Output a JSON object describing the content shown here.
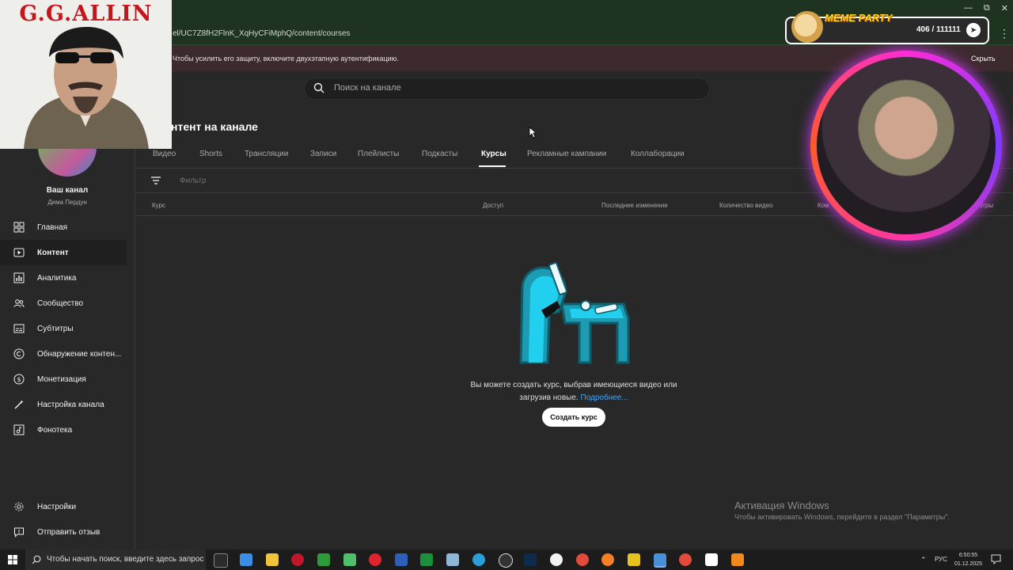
{
  "browser": {
    "url": "el/UC7Z8fH2FlnK_XqHyCFiMphQ/content/courses"
  },
  "alert": {
    "text": "Чтобы усилить его защиту, включите двухэтапную аутентификацию.",
    "hide_label": "Скрыть"
  },
  "search": {
    "placeholder": "Поиск на канале"
  },
  "sidebar": {
    "channel_name": "Ваш канал",
    "channel_handle": "Дима Пердун",
    "items": [
      {
        "label": "Главная"
      },
      {
        "label": "Контент"
      },
      {
        "label": "Аналитика"
      },
      {
        "label": "Сообщество"
      },
      {
        "label": "Субтитры"
      },
      {
        "label": "Обнаружение контен..."
      },
      {
        "label": "Монетизация"
      },
      {
        "label": "Настройка канала"
      },
      {
        "label": "Фонотека"
      }
    ],
    "bottom_items": [
      {
        "label": "Настройки"
      },
      {
        "label": "Отправить отзыв"
      }
    ]
  },
  "main": {
    "title": "нтент на канале",
    "tabs": [
      {
        "label": "Видео"
      },
      {
        "label": "Shorts"
      },
      {
        "label": "Трансляции"
      },
      {
        "label": "Записи"
      },
      {
        "label": "Плейлисты"
      },
      {
        "label": "Подкасты"
      },
      {
        "label": "Курсы"
      },
      {
        "label": "Рекламные кампании"
      },
      {
        "label": "Коллаборации"
      }
    ],
    "filter_placeholder": "Фильтр",
    "columns": [
      "Курс",
      "Доступ",
      "Последнее изменение",
      "Количество видео",
      "Ком",
      "отры"
    ],
    "empty_text": "Вы можете создать курс, выбрав имеющиеся видео или загрузив новые.",
    "empty_link": "Подробнее...",
    "create_button": "Создать курс"
  },
  "overlay": {
    "gg_title": "G.G.ALLIN",
    "meme_title": "MEME PARTY",
    "meme_count": "406 / 111111"
  },
  "watermark": {
    "title": "Активация Windows",
    "subtitle": "Чтобы активировать Windows, перейдите в раздел \"Параметры\"."
  },
  "taskbar": {
    "search_text": "Чтобы начать поиск, введите здесь запрос",
    "lang": "РУС",
    "time": "6:50:55",
    "date": "01.12.2025"
  },
  "colors": {
    "background": "#282828",
    "accent_link": "#3ea6ff",
    "browser_frame": "#1f3321",
    "alert_bg": "#3d2a2e"
  }
}
